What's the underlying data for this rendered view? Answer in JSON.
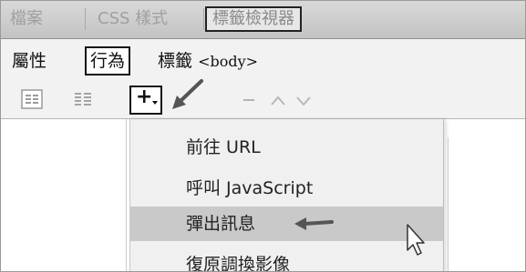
{
  "panel_tabs": [
    {
      "label": "檔案"
    },
    {
      "label": "CSS 樣式"
    },
    {
      "label": "標籤檢視器",
      "active": true
    }
  ],
  "sub_tabs": {
    "attributes_label": "屬性",
    "behaviors_label": "行為",
    "tag_prefix": "標籤",
    "tag_value": "<body>"
  },
  "toolbar": {
    "icons": [
      "show-set-events-icon",
      "show-all-events-icon",
      "add-behavior-icon",
      "remove-behavior-icon",
      "move-up-icon",
      "move-down-icon"
    ],
    "add_button_glyph": "+"
  },
  "behavior_menu": {
    "items": [
      {
        "label": "前往 URL"
      },
      {
        "label": "呼叫 JavaScript"
      },
      {
        "label": "彈出訊息",
        "highlighted": true
      },
      {
        "label": "復原調換影像"
      }
    ]
  },
  "annotation_color": "#555555",
  "highlight_color": "#c9c9c9"
}
